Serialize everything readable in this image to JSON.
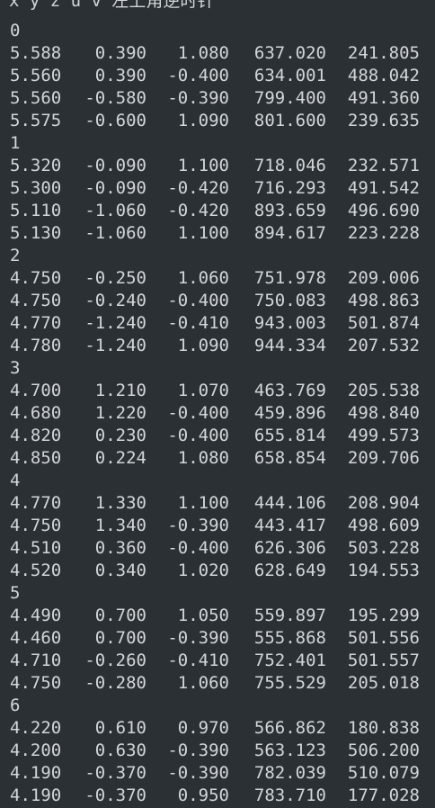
{
  "header": "x y z u v 左上角逆时针",
  "groups": [
    {
      "label": "0",
      "rows": [
        [
          "5.588",
          "0.390",
          "1.080",
          "637.020",
          "241.805"
        ],
        [
          "5.560",
          "0.390",
          "-0.400",
          "634.001",
          "488.042"
        ],
        [
          "5.560",
          "-0.580",
          "-0.390",
          "799.400",
          "491.360"
        ],
        [
          "5.575",
          "-0.600",
          "1.090",
          "801.600",
          "239.635"
        ]
      ]
    },
    {
      "label": "1",
      "rows": [
        [
          "5.320",
          "-0.090",
          "1.100",
          "718.046",
          "232.571"
        ],
        [
          "5.300",
          "-0.090",
          "-0.420",
          "716.293",
          "491.542"
        ],
        [
          "5.110",
          "-1.060",
          "-0.420",
          "893.659",
          "496.690"
        ],
        [
          "5.130",
          "-1.060",
          "1.100",
          "894.617",
          "223.228"
        ]
      ]
    },
    {
      "label": "2",
      "rows": [
        [
          "4.750",
          "-0.250",
          "1.060",
          "751.978",
          "209.006"
        ],
        [
          "4.750",
          "-0.240",
          "-0.400",
          "750.083",
          "498.863"
        ],
        [
          "4.770",
          "-1.240",
          "-0.410",
          "943.003",
          "501.874"
        ],
        [
          "4.780",
          "-1.240",
          "1.090",
          "944.334",
          "207.532"
        ]
      ]
    },
    {
      "label": "3",
      "rows": [
        [
          "4.700",
          "1.210",
          "1.070",
          "463.769",
          "205.538"
        ],
        [
          "4.680",
          "1.220",
          "-0.400",
          "459.896",
          "498.840"
        ],
        [
          "4.820",
          "0.230",
          "-0.400",
          "655.814",
          "499.573"
        ],
        [
          "4.850",
          "0.224",
          "1.080",
          "658.854",
          "209.706"
        ]
      ]
    },
    {
      "label": "4",
      "rows": [
        [
          "4.770",
          "1.330",
          "1.100",
          "444.106",
          "208.904"
        ],
        [
          "4.750",
          "1.340",
          "-0.390",
          "443.417",
          "498.609"
        ],
        [
          "4.510",
          "0.360",
          "-0.400",
          "626.306",
          "503.228"
        ],
        [
          "4.520",
          "0.340",
          "1.020",
          "628.649",
          "194.553"
        ]
      ]
    },
    {
      "label": "5",
      "rows": [
        [
          "4.490",
          "0.700",
          "1.050",
          "559.897",
          "195.299"
        ],
        [
          "4.460",
          "0.700",
          "-0.390",
          "555.868",
          "501.556"
        ],
        [
          "4.710",
          "-0.260",
          "-0.410",
          "752.401",
          "501.557"
        ],
        [
          "4.750",
          "-0.280",
          "1.060",
          "755.529",
          "205.018"
        ]
      ]
    },
    {
      "label": "6",
      "rows": [
        [
          "4.220",
          "0.610",
          "0.970",
          "566.862",
          "180.838"
        ],
        [
          "4.200",
          "0.630",
          "-0.390",
          "563.123",
          "506.200"
        ],
        [
          "4.190",
          "-0.370",
          "-0.390",
          "782.039",
          "510.079"
        ],
        [
          "4.190",
          "-0.370",
          "0.950",
          "783.710",
          "177.028"
        ]
      ]
    }
  ]
}
